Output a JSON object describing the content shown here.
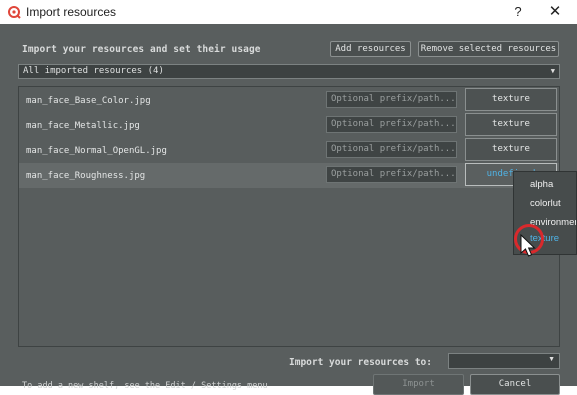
{
  "window": {
    "title": "Import resources",
    "help_glyph": "?",
    "close_glyph": "✕",
    "app_icon": "substance-painter-icon"
  },
  "header": {
    "heading": "Import your resources and set their usage",
    "add_label": "Add resources",
    "remove_label": "Remove selected resources"
  },
  "filter": {
    "value": "All imported resources (4)"
  },
  "resources": [
    {
      "name": "man_face_Base_Color.jpg",
      "prefix_placeholder": "Optional prefix/path...",
      "usage": "texture"
    },
    {
      "name": "man_face_Metallic.jpg",
      "prefix_placeholder": "Optional prefix/path...",
      "usage": "texture"
    },
    {
      "name": "man_face_Normal_OpenGL.jpg",
      "prefix_placeholder": "Optional prefix/path...",
      "usage": "texture"
    },
    {
      "name": "man_face_Roughness.jpg",
      "prefix_placeholder": "Optional prefix/path...",
      "usage": "undefined"
    }
  ],
  "usage_menu": {
    "options": [
      "alpha",
      "colorlut",
      "environment",
      "texture"
    ],
    "highlighted": "texture"
  },
  "footer": {
    "import_to_label": "Import your resources to:",
    "import_to_value": "",
    "hint": "To add a new shelf, see the Edit / Settings menu",
    "import_label": "Import",
    "cancel_label": "Cancel"
  },
  "colors": {
    "dialog_bg": "#595e5e",
    "accent": "#4fb3e6",
    "cursor_ring": "#d9292c"
  }
}
